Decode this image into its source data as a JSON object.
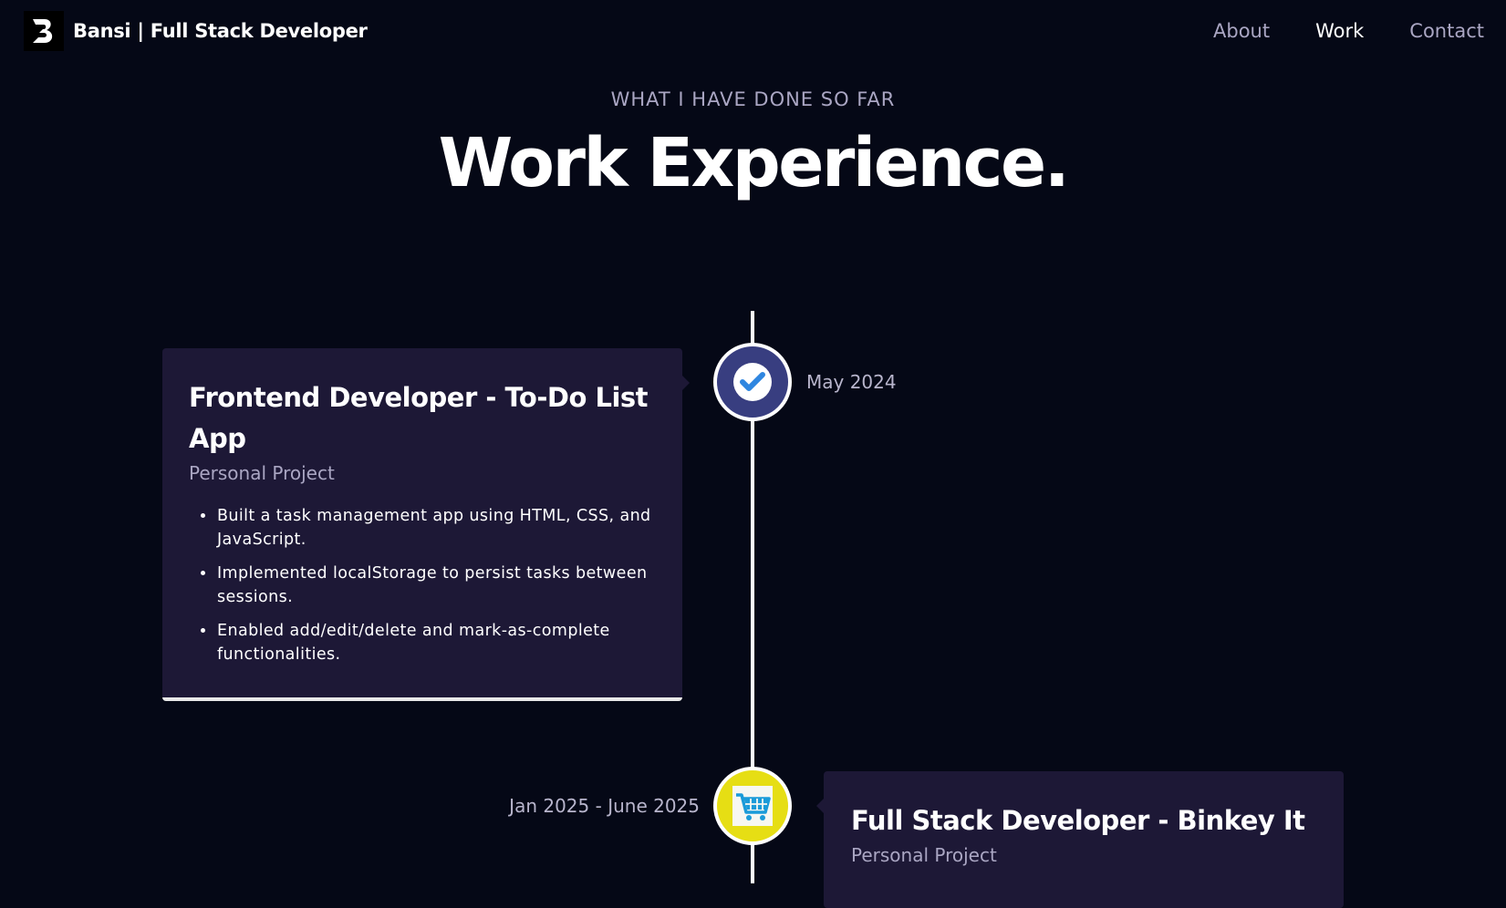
{
  "navbar": {
    "brand_name": "Bansi",
    "brand_separator": " | ",
    "brand_tagline": "Full Stack Developer",
    "links": [
      {
        "label": "About",
        "active": false
      },
      {
        "label": "Work",
        "active": true
      },
      {
        "label": "Contact",
        "active": false
      }
    ]
  },
  "section": {
    "subtitle": "What I have done so far",
    "title": "Work Experience."
  },
  "experiences": [
    {
      "title": "Frontend Developer - To-Do List App",
      "company": "Personal Project",
      "date": "May 2024",
      "icon": "checkmark-icon",
      "icon_bg": "#383e80",
      "points": [
        "Built a task management app using HTML, CSS, and JavaScript.",
        "Implemented localStorage to persist tasks between sessions.",
        "Enabled add/edit/delete and mark-as-complete functionalities."
      ]
    },
    {
      "title": "Full Stack Developer - Binkey It",
      "company": "Personal Project",
      "date": "Jan 2025 - June 2025",
      "icon": "shopping-cart-icon",
      "icon_bg": "#e6de14"
    }
  ],
  "colors": {
    "background": "#050816",
    "card": "#1d1836",
    "secondary_text": "#aaa6c3",
    "white": "#ffffff"
  }
}
